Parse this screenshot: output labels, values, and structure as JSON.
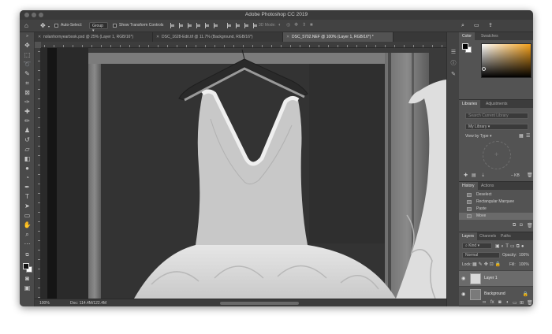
{
  "app": {
    "title": "Adobe Photoshop CC 2019"
  },
  "options_bar": {
    "home_icon": "home-icon",
    "move_icon": "move-tool-icon",
    "auto_select_label": "Auto-Select:",
    "auto_select_checked": false,
    "auto_select_target": "Group",
    "show_transform_label": "Show Transform Controls",
    "show_transform_checked": false,
    "threed_mode_label": "3D Mode:"
  },
  "document_tabs": [
    {
      "title": "nolanhornyearbook.psd @ 25% (Layer 1, RGB/16*)",
      "active": false
    },
    {
      "title": "DSC_1628-Edit.tif @ 11.7% (Background, RGB/16*)",
      "active": false
    },
    {
      "title": "DSC_5702.NEF @ 100% (Layer 1, RGB/16*) *",
      "active": true
    }
  ],
  "status_bar": {
    "zoom": "100%",
    "doc_size": "Doc: 114.4M/122.4M"
  },
  "color_panel": {
    "tabs": [
      "Color",
      "Swatches"
    ],
    "foreground": "#000000",
    "background": "#ffffff",
    "hue_color": "#f4a01a"
  },
  "libraries_panel": {
    "tabs": [
      "Libraries",
      "Adjustments"
    ],
    "search_placeholder": "Search Current Library",
    "library_select": "My Library",
    "view_by_label": "View by Type",
    "size_label": "– KB"
  },
  "history_panel": {
    "tabs": [
      "History",
      "Actions"
    ],
    "items": [
      {
        "label": "Deselect",
        "selected": false
      },
      {
        "label": "Rectangular Marquee",
        "selected": false
      },
      {
        "label": "Paste",
        "selected": false
      },
      {
        "label": "Move",
        "selected": true
      }
    ]
  },
  "layers_panel": {
    "tabs": [
      "Layers",
      "Channels",
      "Paths"
    ],
    "filter_label": "Kind",
    "blend_mode": "Normal",
    "opacity_label": "Opacity:",
    "opacity_value": "100%",
    "lock_label": "Lock:",
    "fill_label": "Fill:",
    "fill_value": "100%",
    "layers": [
      {
        "name": "Layer 1",
        "selected": true,
        "visible": true,
        "locked": false
      },
      {
        "name": "Background",
        "selected": false,
        "visible": true,
        "locked": true
      }
    ]
  }
}
